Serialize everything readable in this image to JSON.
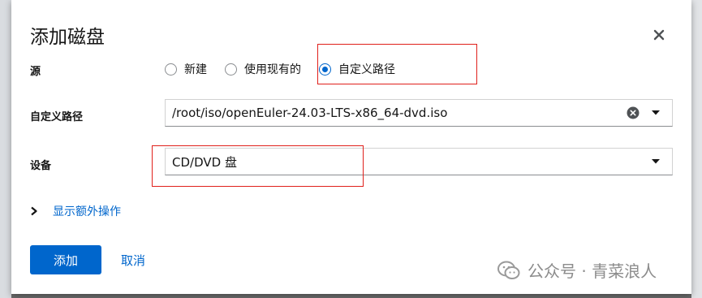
{
  "dialog": {
    "title": "添加磁盘"
  },
  "source": {
    "label": "源",
    "options": [
      {
        "label": "新建",
        "checked": false
      },
      {
        "label": "使用现有的",
        "checked": false
      },
      {
        "label": "自定义路径",
        "checked": true
      }
    ]
  },
  "custom_path": {
    "label": "自定义路径",
    "value": "/root/iso/openEuler-24.03-LTS-x86_64-dvd.iso"
  },
  "device": {
    "label": "设备",
    "value": "CD/DVD 盘"
  },
  "extra_actions": {
    "label": "显示额外操作"
  },
  "footer": {
    "add_label": "添加",
    "cancel_label": "取消"
  },
  "watermark": {
    "text": "公众号 · 青菜浪人"
  },
  "colors": {
    "primary": "#0066cc",
    "highlight": "#e0201b",
    "text": "#151515"
  }
}
